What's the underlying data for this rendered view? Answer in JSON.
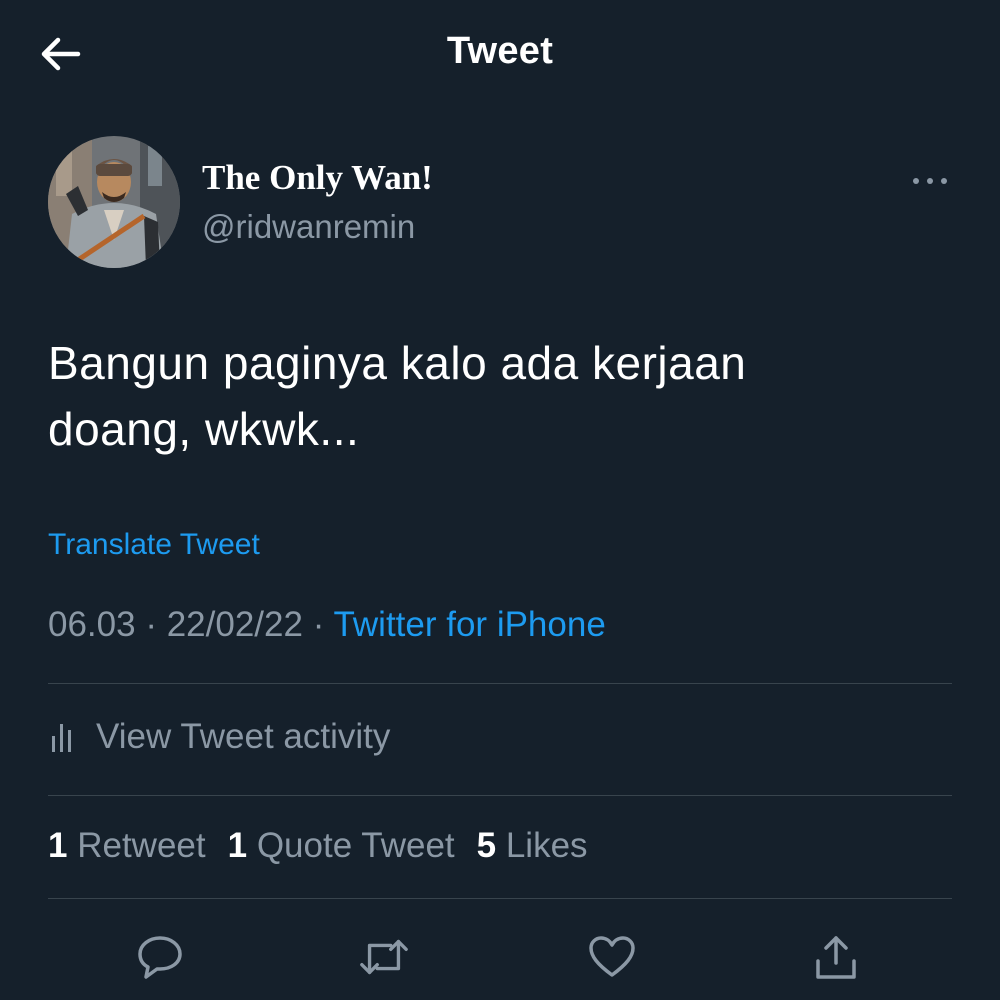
{
  "header": {
    "title": "Tweet",
    "back_icon": "arrow-left-icon"
  },
  "author": {
    "display_name": "The Only Wan!",
    "handle": "@ridwanremin",
    "more_icon": "more-horizontal-icon"
  },
  "tweet": {
    "text_line1": "Bangun paginya kalo ada kerjaan",
    "text_line2": "doang, wkwk...",
    "translate_label": "Translate Tweet",
    "time": "06.03",
    "separator": "·",
    "date": "22/02/22",
    "source": "Twitter for iPhone"
  },
  "activity": {
    "label": "View Tweet activity",
    "icon": "activity-bars-icon"
  },
  "stats": {
    "retweets_count": "1",
    "retweets_label": "Retweet",
    "quotes_count": "1",
    "quotes_label": "Quote Tweet",
    "likes_count": "5",
    "likes_label": "Likes"
  },
  "actions": [
    "reply-icon",
    "retweet-icon",
    "like-icon",
    "share-icon"
  ],
  "colors": {
    "background": "#15202b",
    "text_primary": "#ffffff",
    "text_secondary": "#8b98a5",
    "accent": "#1d9bf0",
    "divider": "#38444d"
  }
}
